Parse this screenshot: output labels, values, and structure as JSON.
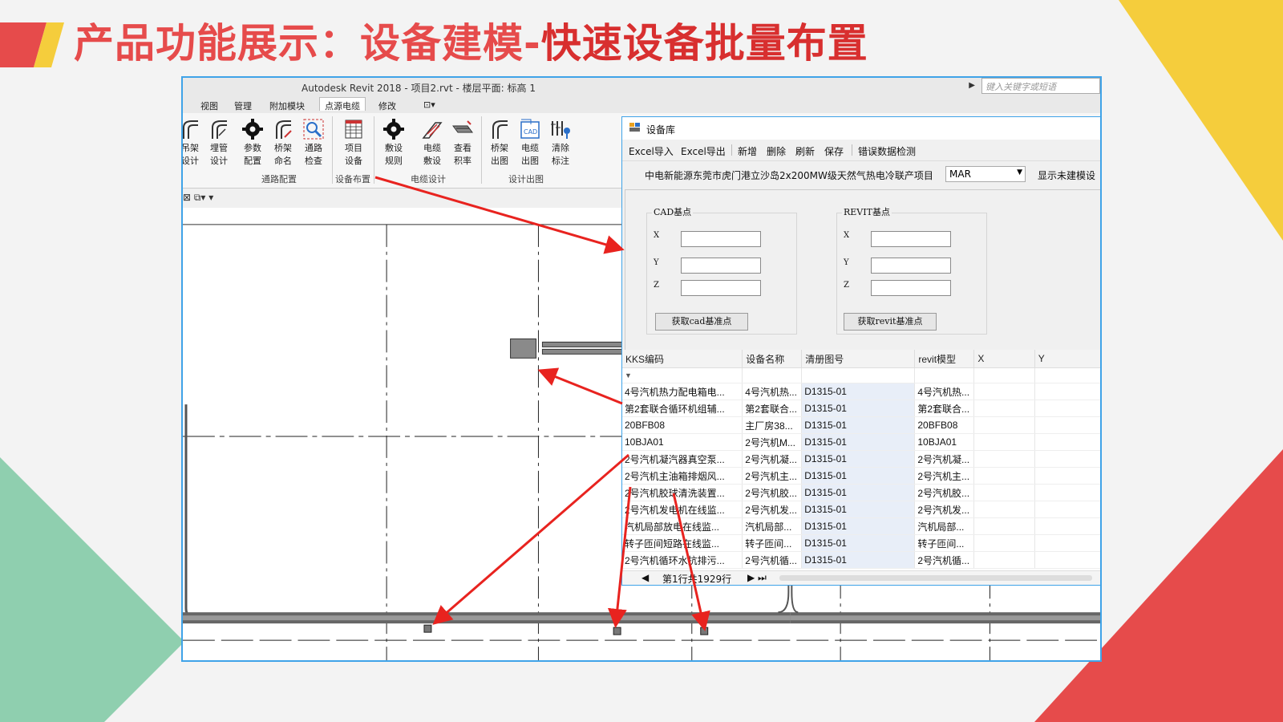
{
  "slide": {
    "title_part1": "产品功能展示：设备建模-",
    "title_part2": "快速设备批量布置"
  },
  "colors": {
    "accent_red": "#e64b4b",
    "accent_yellow": "#f5cd3c",
    "accent_green": "#8fcfaf",
    "frame_blue": "#3fa3e8",
    "arrow_red": "#e8231f"
  },
  "revit": {
    "window_title": "Autodesk Revit 2018 -   项目2.rvt - 楼层平面: 标高 1",
    "search_placeholder": "键入关键字或短语",
    "tabs": [
      "视图",
      "管理",
      "附加模块",
      "点源电缆",
      "修改"
    ],
    "active_tab_index": 3,
    "ribbon_buttons": [
      {
        "label1": "吊架",
        "label2": "设计",
        "icon": "hanger-icon"
      },
      {
        "label1": "埋管",
        "label2": "设计",
        "icon": "conduit-icon"
      },
      {
        "label1": "参数",
        "label2": "配置",
        "icon": "gear-icon"
      },
      {
        "label1": "桥架",
        "label2": "命名",
        "icon": "tray-icon"
      },
      {
        "label1": "通路",
        "label2": "检查",
        "icon": "inspect-icon"
      },
      {
        "label1": "项目",
        "label2": "设备",
        "icon": "table-icon"
      },
      {
        "label1": "敷设",
        "label2": "规则",
        "icon": "gear-icon"
      },
      {
        "label1": "电缆",
        "label2": "敷设",
        "icon": "cable-icon"
      },
      {
        "label1": "查看",
        "label2": "积率",
        "icon": "tray-view-icon"
      },
      {
        "label1": "桥架",
        "label2": "出图",
        "icon": "tray-draw-icon"
      },
      {
        "label1": "电缆",
        "label2": "出图",
        "icon": "cad-icon"
      },
      {
        "label1": "清除",
        "label2": "标注",
        "icon": "clear-tag-icon"
      }
    ],
    "ribbon_groups": [
      "通路配置",
      "设备布置",
      "电缆设计",
      "设计出图"
    ]
  },
  "dialog": {
    "title": "设备库",
    "menu": [
      "Excel导入",
      "Excel导出",
      "新增",
      "删除",
      "刷新",
      "保存",
      "错误数据检测"
    ],
    "project_name": "中电新能源东莞市虎门港立沙岛2x200MW级天然气热电冷联产项目",
    "unit_select": "MAR",
    "show_unbuilt": "显示未建模设",
    "cad_group": "CAD基点",
    "revit_group": "REVIT基点",
    "axis_labels": [
      "X",
      "Y",
      "Z"
    ],
    "cad_button": "获取cad基准点",
    "revit_button": "获取revit基准点",
    "columns": [
      "KKS编码",
      "设备名称",
      "清册图号",
      "revit模型",
      "X",
      "Y"
    ],
    "filter_icon": "▼",
    "rows": [
      [
        "4号汽机热力配电箱电...",
        "4号汽机热...",
        "D1315-01",
        "4号汽机热..."
      ],
      [
        "第2套联合循环机组辅...",
        "第2套联合...",
        "D1315-01",
        "第2套联合..."
      ],
      [
        "20BFB08",
        "主厂房38...",
        "D1315-01",
        "20BFB08"
      ],
      [
        "10BJA01",
        "2号汽机M...",
        "D1315-01",
        "10BJA01"
      ],
      [
        "2号汽机凝汽器真空泵...",
        "2号汽机凝...",
        "D1315-01",
        "2号汽机凝..."
      ],
      [
        "2号汽机主油箱排烟风...",
        "2号汽机主...",
        "D1315-01",
        "2号汽机主..."
      ],
      [
        "2号汽机胶球清洗装置...",
        "2号汽机胶...",
        "D1315-01",
        "2号汽机胶..."
      ],
      [
        "2号汽机发电机在线监...",
        "2号汽机发...",
        "D1315-01",
        "2号汽机发..."
      ],
      [
        "汽机局部放电在线监...",
        "汽机局部...",
        "D1315-01",
        "汽机局部..."
      ],
      [
        "转子匝间短路在线监...",
        "转子匝间...",
        "D1315-01",
        "转子匝间..."
      ],
      [
        "2号汽机循环水抗排污...",
        "2号汽机循...",
        "D1315-01",
        "2号汽机循..."
      ]
    ],
    "pager_text": "第1行共1929行"
  }
}
